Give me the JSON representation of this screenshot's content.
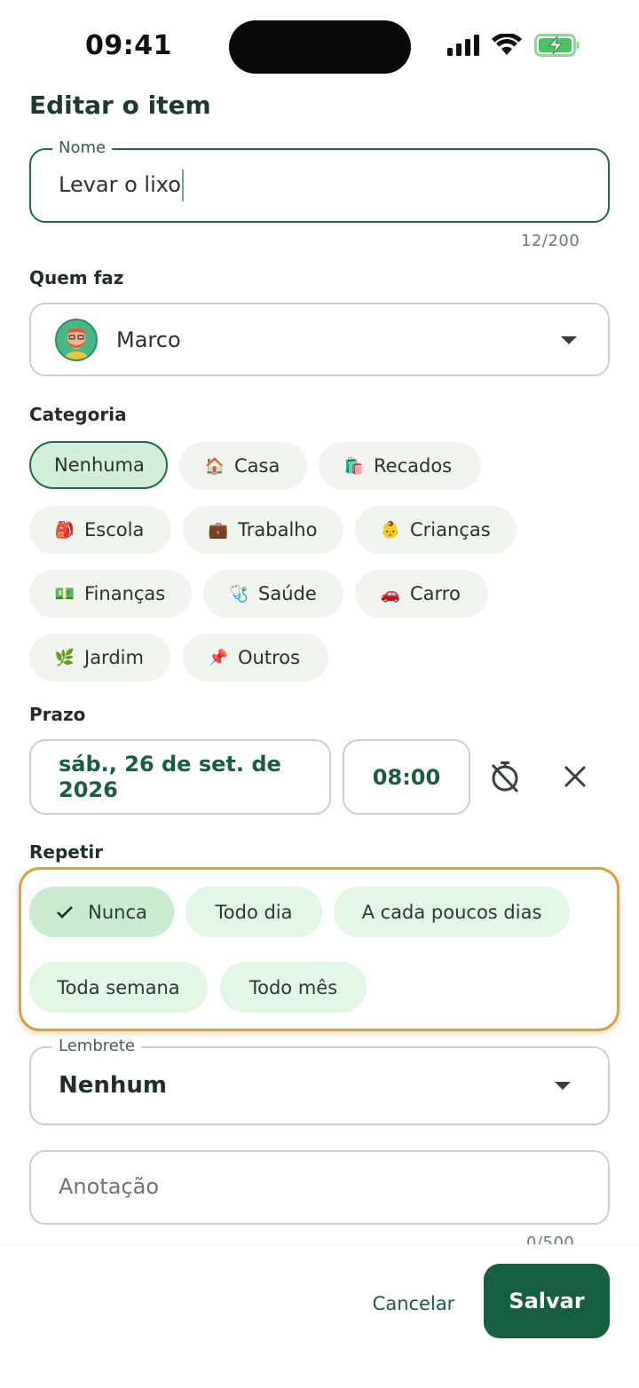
{
  "status_bar": {
    "time": "09:41",
    "icons": [
      "cellular-signal-icon",
      "wifi-icon",
      "battery-charging-icon"
    ]
  },
  "header": {
    "title": "Editar o item"
  },
  "name_field": {
    "label": "Nome",
    "value": "Levar o lixo",
    "counter": "12/200"
  },
  "assignee": {
    "label": "Quem faz",
    "name": "Marco"
  },
  "category": {
    "label": "Categoria",
    "options": [
      {
        "label": "Nenhuma",
        "emoji": "",
        "selected": true
      },
      {
        "label": "Casa",
        "emoji": "🏠"
      },
      {
        "label": "Recados",
        "emoji": "🛍️"
      },
      {
        "label": "Escola",
        "emoji": "🎒"
      },
      {
        "label": "Trabalho",
        "emoji": "💼"
      },
      {
        "label": "Crianças",
        "emoji": "👶"
      },
      {
        "label": "Finanças",
        "emoji": "💵"
      },
      {
        "label": "Saúde",
        "emoji": "🩺"
      },
      {
        "label": "Carro",
        "emoji": "🚗"
      },
      {
        "label": "Jardim",
        "emoji": "🌿"
      },
      {
        "label": "Outros",
        "emoji": "📌"
      }
    ]
  },
  "deadline": {
    "label": "Prazo",
    "date": "sáb., 26 de set. de 2026",
    "time": "08:00"
  },
  "repeat": {
    "label": "Repetir",
    "options": [
      {
        "label": "Nunca",
        "selected": true
      },
      {
        "label": "Todo dia"
      },
      {
        "label": "A cada poucos dias"
      },
      {
        "label": "Toda semana"
      },
      {
        "label": "Todo mês"
      }
    ]
  },
  "reminder": {
    "label": "Lembrete",
    "value": "Nenhum"
  },
  "note": {
    "placeholder": "Anotação",
    "counter": "0/500"
  },
  "actions": {
    "cancel": "Cancelar",
    "save": "Salvar"
  },
  "colors": {
    "primary": "#155e3e",
    "chip_selected": "#d2efd9",
    "highlight_frame": "#d9a03f"
  }
}
